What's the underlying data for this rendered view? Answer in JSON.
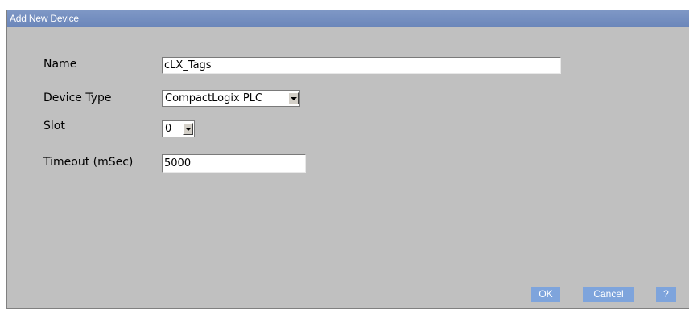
{
  "window": {
    "title": "Add New Device"
  },
  "form": {
    "name": {
      "label": "Name",
      "value": "cLX_Tags"
    },
    "device_type": {
      "label": "Device Type",
      "value": "CompactLogix PLC"
    },
    "slot": {
      "label": "Slot",
      "value": "0"
    },
    "timeout": {
      "label": "Timeout (mSec)",
      "value": "5000"
    }
  },
  "buttons": {
    "ok": "OK",
    "cancel": "Cancel",
    "help": "?"
  },
  "colors": {
    "titlebar": "#7290c2",
    "dialog_bg": "#c0c0c0",
    "button_bg": "#7ea4dc"
  },
  "icons": {
    "dropdown": "chevron-down-icon"
  }
}
